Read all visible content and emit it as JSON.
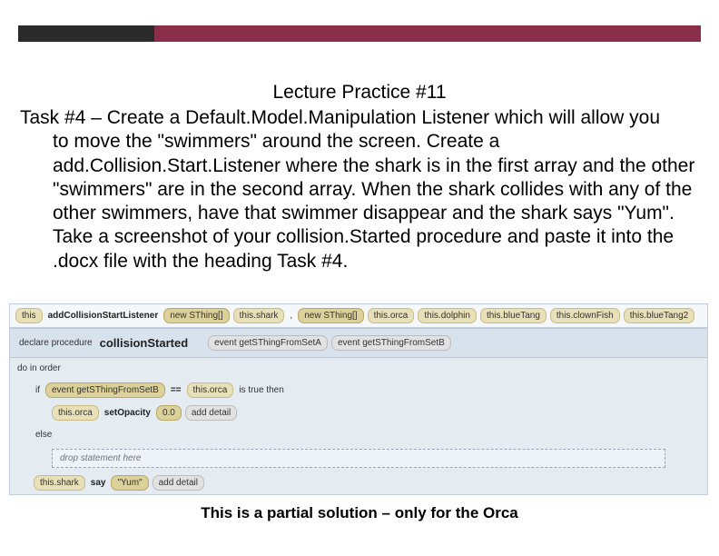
{
  "title": "Lecture Practice #11",
  "task_lead": "Task #4 – Create a Default.Model.Manipulation Listener which will allow you",
  "task_body": "to move the \"swimmers\" around the screen.  Create a add.Collision.Start.Listener where the shark is in the first array and the other \"swimmers\" are in the second array.  When the shark collides with any of the other swimmers, have that swimmer disappear and the shark says \"Yum\".  Take a screenshot of your collision.Started procedure and paste it into the .docx file with the heading Task #4.",
  "caption": "This is a partial solution – only for the Orca",
  "code": {
    "line1": {
      "this": "this",
      "method": "addCollisionStartListener",
      "arr1_label": "new SThing[]",
      "arr1_item": "this.shark",
      "comma": ",",
      "arr2_label": "new SThing[]",
      "arr2_items": [
        "this.orca",
        "this.dolphin",
        "this.blueTang",
        "this.clownFish",
        "this.blueTang2"
      ]
    },
    "proc": {
      "declare": "declare procedure",
      "name": "collisionStarted",
      "p1": "event  getSThingFromSetA",
      "p2": "event  getSThingFromSetB"
    },
    "do_in_order": "do in order",
    "if_row": {
      "if": "if",
      "expr1": "event  getSThingFromSetB",
      "eq": "==",
      "expr2": "this.orca",
      "tail": "is true then"
    },
    "opacity_row": {
      "target": "this.orca",
      "method": "setOpacity",
      "val": "0.0",
      "detail": "add detail"
    },
    "else": "else",
    "drop": "drop statement here",
    "say_row": {
      "target": "this.shark",
      "method": "say",
      "val": "\"Yum\"",
      "detail": "add detail"
    }
  }
}
